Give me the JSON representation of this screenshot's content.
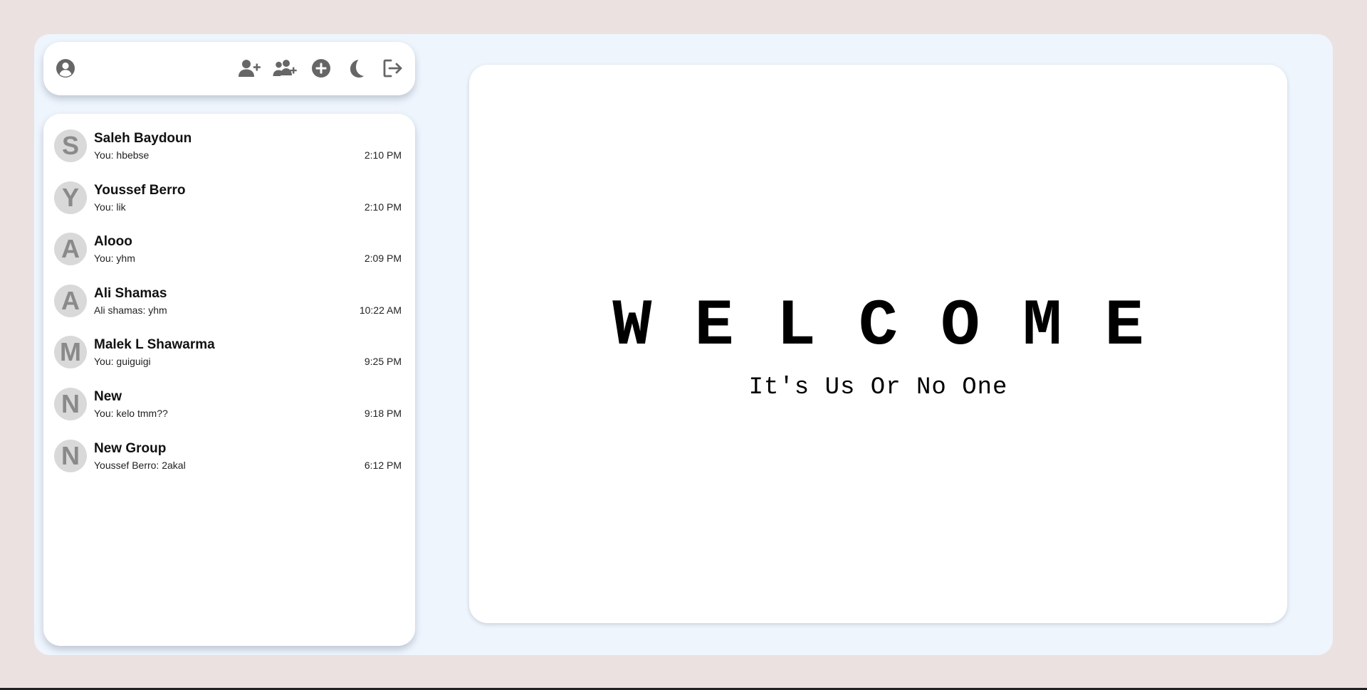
{
  "colors": {
    "page_background": "#ebe1e1",
    "frame_background": "#eef5fd",
    "panel_background": "#ffffff",
    "icon_color": "#666666",
    "avatar_background": "#d9d9d9",
    "avatar_letter": "#8a8a8a"
  },
  "topbar": {
    "icons": [
      "profile-icon",
      "add-user-icon",
      "add-group-icon",
      "plus-circle-icon",
      "moon-icon",
      "logout-icon"
    ]
  },
  "chats": [
    {
      "initial": "S",
      "name": "Saleh Baydoun",
      "preview": "You: hbebse",
      "time": "2:10 PM"
    },
    {
      "initial": "Y",
      "name": "Youssef Berro",
      "preview": "You: lik",
      "time": "2:10 PM"
    },
    {
      "initial": "A",
      "name": "Alooo",
      "preview": "You: yhm",
      "time": "2:09 PM"
    },
    {
      "initial": "A",
      "name": "Ali Shamas",
      "preview": "Ali shamas: yhm",
      "time": "10:22 AM"
    },
    {
      "initial": "M",
      "name": "Malek L Shawarma",
      "preview": "You: guiguigi",
      "time": "9:25 PM"
    },
    {
      "initial": "N",
      "name": "New",
      "preview": "You: kelo tmm??",
      "time": "9:18 PM"
    },
    {
      "initial": "N",
      "name": "New Group",
      "preview": "Youssef Berro: 2akal",
      "time": "6:12 PM"
    }
  ],
  "welcome": {
    "title": "WELCOME",
    "subtitle": "It's Us Or No One"
  }
}
